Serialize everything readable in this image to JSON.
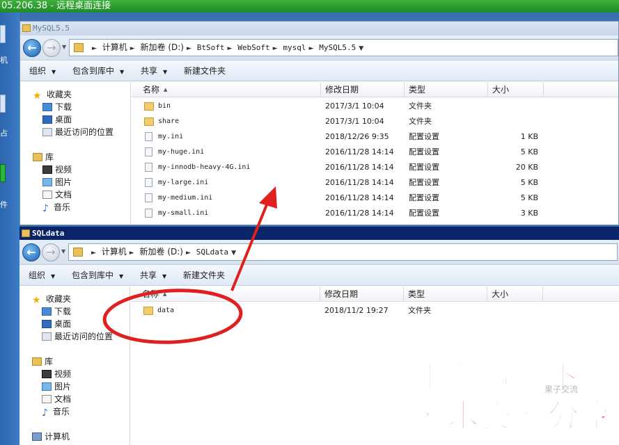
{
  "rdp": {
    "title": "05.206.38 - 远程桌面连接",
    "side_labels": [
      "机",
      "占",
      "件"
    ]
  },
  "win1": {
    "title": "MySQL5.5",
    "breadcrumb": [
      "计算机",
      "新加卷 (D:)",
      "BtSoft",
      "WebSoft",
      "mysql",
      "MySQL5.5"
    ],
    "toolbar": {
      "organize": "组织",
      "include_library": "包含到库中",
      "share": "共享",
      "new_folder": "新建文件夹"
    },
    "columns": {
      "name": "名称",
      "modified": "修改日期",
      "type": "类型",
      "size": "大小"
    },
    "files": [
      {
        "icon": "folder",
        "name": "bin",
        "modified": "2017/3/1 10:04",
        "type": "文件夹",
        "size": ""
      },
      {
        "icon": "folder",
        "name": "share",
        "modified": "2017/3/1 10:04",
        "type": "文件夹",
        "size": ""
      },
      {
        "icon": "ini",
        "name": "my.ini",
        "modified": "2018/12/26 9:35",
        "type": "配置设置",
        "size": "1 KB"
      },
      {
        "icon": "ini",
        "name": "my-huge.ini",
        "modified": "2016/11/28 14:14",
        "type": "配置设置",
        "size": "5 KB"
      },
      {
        "icon": "ini",
        "name": "my-innodb-heavy-4G.ini",
        "modified": "2016/11/28 14:14",
        "type": "配置设置",
        "size": "20 KB"
      },
      {
        "icon": "ini",
        "name": "my-large.ini",
        "modified": "2016/11/28 14:14",
        "type": "配置设置",
        "size": "5 KB"
      },
      {
        "icon": "ini",
        "name": "my-medium.ini",
        "modified": "2016/11/28 14:14",
        "type": "配置设置",
        "size": "5 KB"
      },
      {
        "icon": "ini",
        "name": "my-small.ini",
        "modified": "2016/11/28 14:14",
        "type": "配置设置",
        "size": "3 KB"
      }
    ]
  },
  "win2": {
    "title": "SQLdata",
    "breadcrumb": [
      "计算机",
      "新加卷 (D:)",
      "SQLdata"
    ],
    "toolbar": {
      "organize": "组织",
      "include_library": "包含到库中",
      "share": "共享",
      "new_folder": "新建文件夹"
    },
    "columns": {
      "name": "名称",
      "modified": "修改日期",
      "type": "类型",
      "size": "大小"
    },
    "files": [
      {
        "icon": "folder",
        "name": "data",
        "modified": "2018/11/2 19:27",
        "type": "文件夹",
        "size": ""
      }
    ]
  },
  "navpane": {
    "favorites": "收藏夹",
    "downloads": "下载",
    "desktop": "桌面",
    "recent": "最近访问的位置",
    "libraries": "库",
    "videos": "视频",
    "pictures": "图片",
    "documents": "文档",
    "music": "音乐",
    "computer": "计算机"
  },
  "watermark": {
    "line1": "手游资源下载",
    "line2": "技术交流分享",
    "ghost": "果子交流"
  },
  "colors": {
    "annotation": "#e02020",
    "watermark": "#d71d1d",
    "active_title": "#0a246a"
  }
}
